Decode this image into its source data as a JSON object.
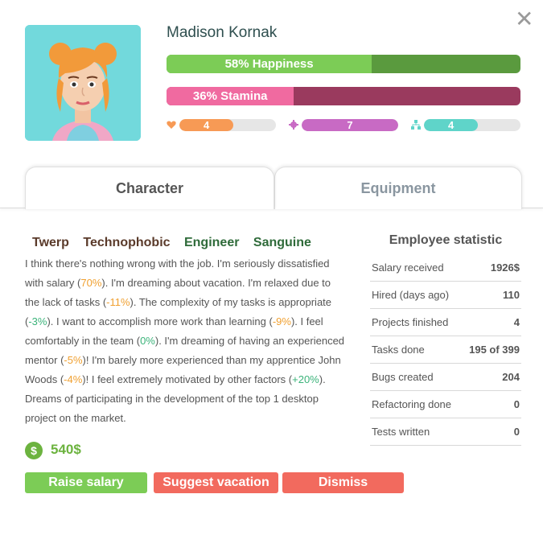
{
  "employee": {
    "name": "Madison Kornak",
    "happiness": {
      "label": "58% Happiness",
      "percent": 58
    },
    "stamina": {
      "label": "36% Stamina",
      "percent": 36
    },
    "stats": [
      {
        "icon": "heart-icon",
        "value": "4",
        "level": 0.56,
        "color": "#f79a55"
      },
      {
        "icon": "gear-icon",
        "value": "7",
        "level": 1.0,
        "color": "#c86ac4"
      },
      {
        "icon": "team-icon",
        "value": "4",
        "level": 0.56,
        "color": "#5fd4c9"
      }
    ]
  },
  "tabs": [
    {
      "label": "Character",
      "active": true
    },
    {
      "label": "Equipment",
      "active": false
    }
  ],
  "traits": [
    {
      "label": "Twerp",
      "color": "#5a3a2a"
    },
    {
      "label": "Technophobic",
      "color": "#5a3a2a"
    },
    {
      "label": "Engineer",
      "color": "#2f6b3a"
    },
    {
      "label": "Sanguine",
      "color": "#2f6b3a"
    }
  ],
  "description": [
    {
      "t": "I think there's nothing wrong with the job. I'm seriously dissatisfied with salary ("
    },
    {
      "t": "70%",
      "c": "neg"
    },
    {
      "t": "). I'm dreaming about vacation. I'm relaxed due to the lack of tasks ("
    },
    {
      "t": "-11%",
      "c": "neg"
    },
    {
      "t": "). The complexity of my tasks is appropriate ("
    },
    {
      "t": "-3%",
      "c": "pos"
    },
    {
      "t": "). I want to accomplish more work than learning ("
    },
    {
      "t": "-9%",
      "c": "neg"
    },
    {
      "t": "). I feel comfortably in the team ("
    },
    {
      "t": "0%",
      "c": "pos"
    },
    {
      "t": "). I'm dreaming of having an experienced mentor ("
    },
    {
      "t": "-5%",
      "c": "neg"
    },
    {
      "t": ")! I'm barely more experienced than my apprentice John Woods ("
    },
    {
      "t": "-4%",
      "c": "neg"
    },
    {
      "t": ")! I feel extremely motivated by other factors ("
    },
    {
      "t": "+20%",
      "c": "pos"
    },
    {
      "t": "). Dreams of participating in the development of the top 1 desktop project on the market."
    }
  ],
  "salary": {
    "amount": "540$",
    "icon": "dollar-coin-icon"
  },
  "buttons": {
    "raise": "Raise salary",
    "vacation": "Suggest vacation",
    "dismiss": "Dismiss"
  },
  "statistic": {
    "title": "Employee statistic",
    "rows": [
      {
        "k": "Salary received",
        "v": "1926$"
      },
      {
        "k": "Hired (days ago)",
        "v": "110"
      },
      {
        "k": "Projects finished",
        "v": "4"
      },
      {
        "k": "Tasks done",
        "v": "195 of 399"
      },
      {
        "k": "Bugs created",
        "v": "204"
      },
      {
        "k": "Refactoring done",
        "v": "0"
      },
      {
        "k": "Tests written",
        "v": "0"
      }
    ]
  },
  "close": {
    "icon": "close-icon",
    "symbol": "✕"
  },
  "colors": {
    "happiness_fill": "#7ccc56",
    "happiness_track": "#5a9a3e",
    "stamina_fill": "#f06aa0",
    "stamina_track": "#9a3a5e",
    "raise": "#7ccc56",
    "vacation": "#f26a5e",
    "dismiss": "#f26a5e"
  }
}
